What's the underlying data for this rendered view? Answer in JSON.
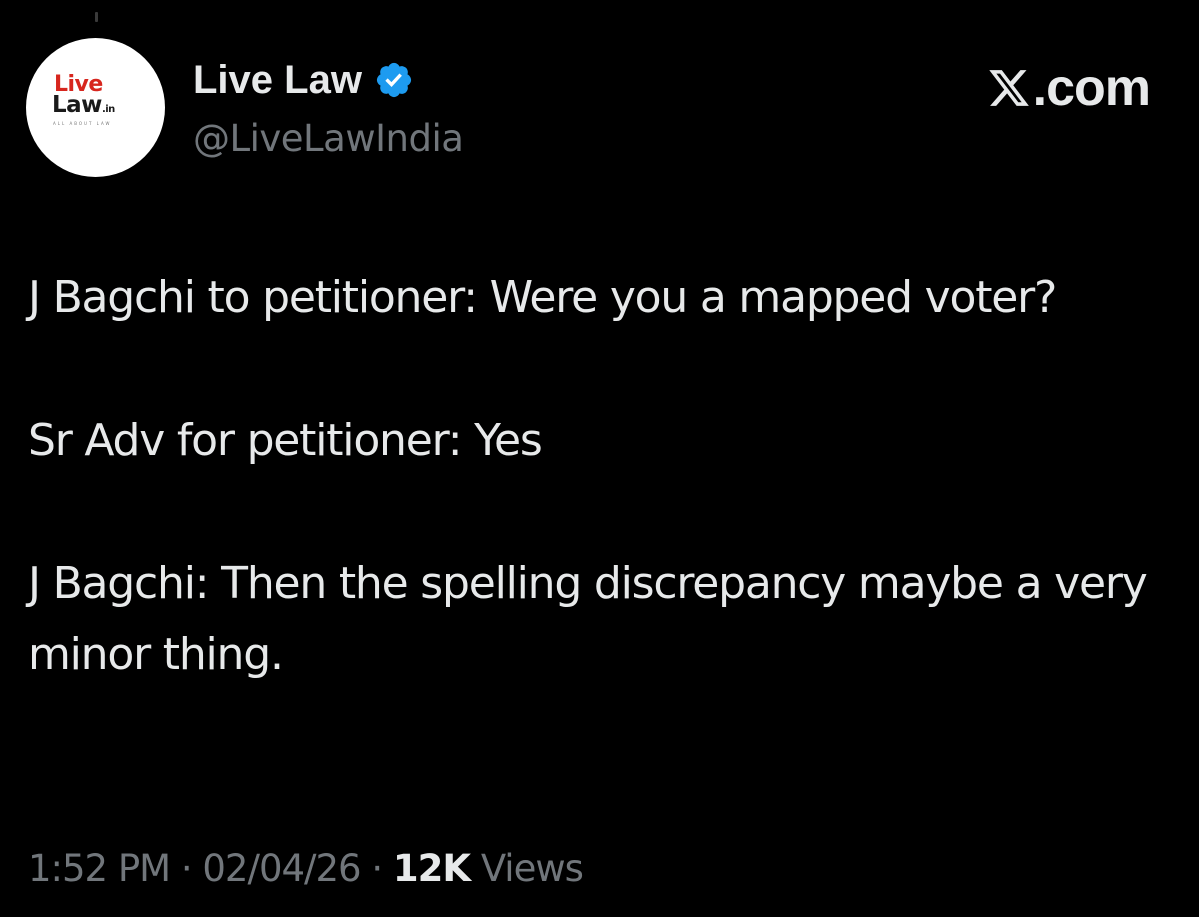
{
  "avatar": {
    "logo_line1": "Live",
    "logo_line2": "Law",
    "logo_suffix": ".in",
    "logo_tagline": "ALL ABOUT LAW",
    "colors": {
      "live": "#d7261e",
      "law": "#1a1a1a",
      "background": "#ffffff"
    }
  },
  "author": {
    "display_name": "Live Law",
    "handle": "@LiveLawIndia",
    "verified": true,
    "verified_icon": "verified-badge-icon",
    "verified_color": "#1d9bf0"
  },
  "brand": {
    "icon": "x-logo-icon",
    "text": ".com"
  },
  "tweet": {
    "paragraphs": [
      "J Bagchi to petitioner: Were you a mapped voter?",
      "Sr Adv for petitioner: Yes",
      "J Bagchi: Then the spelling discrepancy maybe a very minor thing."
    ]
  },
  "meta": {
    "time": "1:52 PM",
    "separator": "·",
    "date": "02/04/26",
    "views_count": "12K",
    "views_label": "Views"
  },
  "theme": {
    "background": "#000000",
    "text_primary": "#e7e9ea",
    "text_secondary": "#71767b"
  }
}
